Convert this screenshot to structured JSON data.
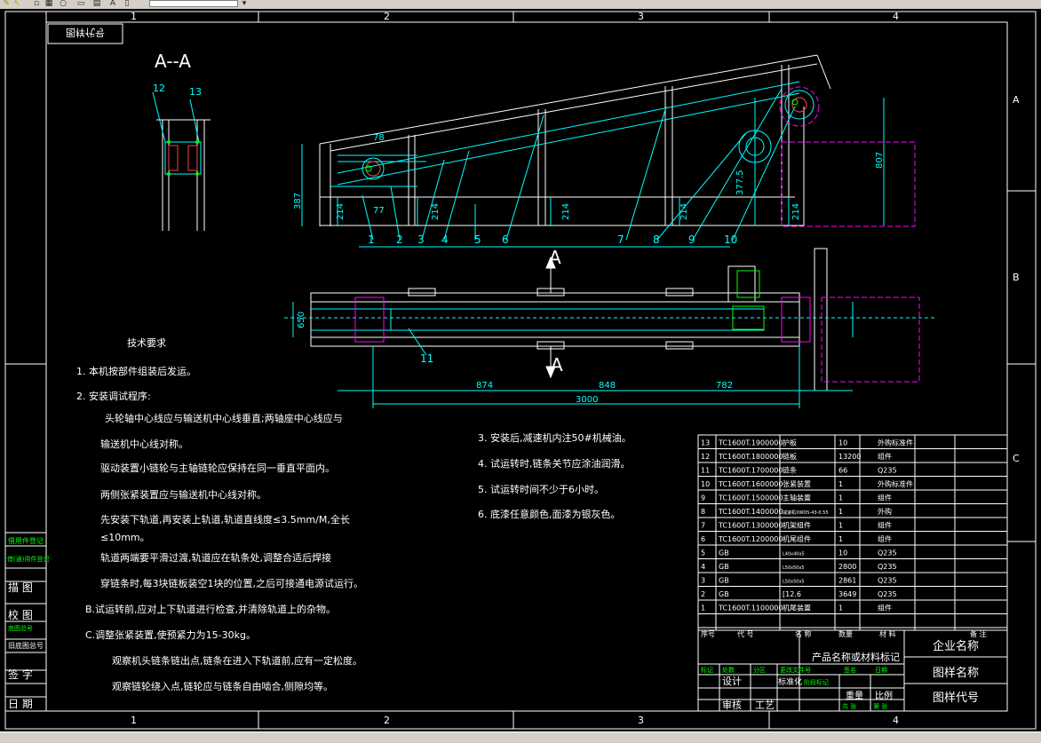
{
  "toolbar": {
    "icons": [
      "pencil-icon",
      "yellow-arrow-icon",
      "small-square-icon",
      "circle-icon",
      "frame-icon",
      "grid-icon",
      "text-icon",
      "rectangle-icon"
    ],
    "layer_value": ""
  },
  "frame": {
    "col_labels": [
      "1",
      "2",
      "3",
      "4"
    ],
    "row_labels": [
      "A",
      "B",
      "C"
    ],
    "mirror_title": "图样代号"
  },
  "section": {
    "title": "A--A",
    "balloon_12": "12",
    "balloon_13": "13"
  },
  "elevation": {
    "dims": [
      "78",
      "77",
      "387",
      "214",
      "214",
      "214",
      "214",
      "214",
      "377.5",
      "807"
    ],
    "balloons": [
      "1",
      "2",
      "3",
      "4",
      "5",
      "6",
      "7",
      "8",
      "9",
      "10"
    ]
  },
  "plan": {
    "section_mark": "A",
    "balloon_11": "11",
    "width_dim": "650",
    "dims": [
      "874",
      "848",
      "782",
      "3000"
    ]
  },
  "tech": {
    "heading": "技术要求",
    "lines": [
      "1.  本机按部件组装后发运。",
      "2.  安装调试程序:",
      "头轮轴中心线应与输送机中心线垂直;两轴座中心线应与",
      "输送机中心线对称。",
      "驱动装置小链轮与主轴链轮应保持在同一垂直平面内。",
      "两侧张紧装置应与输送机中心线对称。",
      "先安装下轨道,再安装上轨道,轨道直线度≤3.5mm/M,全长",
      "≤10mm。",
      "轨道两端要平滑过渡,轨道应在轨条处,调整合适后焊接",
      "穿链条时,每3块链板装空1块的位置,之后可接通电源试运行。",
      "B.试运转前,应对上下轨道进行检查,并清除轨道上的杂物。",
      "C.调整张紧装置,使预紧力为15-30kg。",
      "观察机头链条链出点,链条在进入下轨道前,应有一定松度。",
      "观察链轮绕入点,链轮应与链条自由啮合,侧隙均等。"
    ],
    "lines_right": [
      "3.  安装后,减速机内注50#机械油。",
      "4.  试运转时,链条关节应涂油润滑。",
      "5.  试运转时间不少于6小时。",
      "6.  底漆任意颜色,面漆为银灰色。"
    ]
  },
  "left_strip": {
    "labels": [
      "借(通)用件登记",
      "旧底图总号",
      "描 图",
      "校 图",
      "底图总号",
      "签 字",
      "日 期",
      "借用件登记",
      "描图",
      "校对",
      "日期"
    ]
  },
  "bom": {
    "rows": [
      {
        "no": "13",
        "code": "TC1600T.1900000",
        "name": "护板",
        "qty": "10",
        "mat": "外购标准件"
      },
      {
        "no": "12",
        "code": "TC1600T.1800000",
        "name": "链板",
        "qty": "13200",
        "mat": "组件"
      },
      {
        "no": "11",
        "code": "TC1600T.1700000",
        "name": "链条",
        "qty": "66",
        "mat": "Q235"
      },
      {
        "no": "10",
        "code": "TC1600T.1600000",
        "name": "张紧装置",
        "qty": "1",
        "mat": "外购标准件"
      },
      {
        "no": "9",
        "code": "TC1600T.1500000",
        "name": "主轴装置",
        "qty": "1",
        "mat": "组件"
      },
      {
        "no": "8",
        "code": "TC1600T.1400000",
        "name": "减速机XWD5-43-0.55",
        "qty": "1",
        "mat": "外购"
      },
      {
        "no": "7",
        "code": "TC1600T.1300000",
        "name": "机架组件",
        "qty": "1",
        "mat": "组件"
      },
      {
        "no": "6",
        "code": "TC1600T.1200000",
        "name": "机尾组件",
        "qty": "1",
        "mat": "组件"
      },
      {
        "no": "5",
        "code": "GB",
        "name": "L40x40x5",
        "qty": "10",
        "mat": "Q235"
      },
      {
        "no": "4",
        "code": "GB",
        "name": "L50x50x5",
        "qty": "2800",
        "mat": "Q235"
      },
      {
        "no": "3",
        "code": "GB",
        "name": "L50x50x5",
        "qty": "2861",
        "mat": "Q235"
      },
      {
        "no": "2",
        "code": "GB",
        "name": "[12.6",
        "qty": "3649",
        "mat": "Q235"
      },
      {
        "no": "1",
        "code": "TC1600T.1100000",
        "name": "机尾装置",
        "qty": "1",
        "mat": "组件"
      }
    ],
    "header": {
      "no": "序号",
      "code": "代 号",
      "name": "名 称",
      "qty": "数量",
      "mat": "材 料",
      "w1": "单件",
      "w2": "总计",
      "weight": "重量",
      "note": "备 注"
    }
  },
  "title_block": {
    "product": "产品名称或材料标记",
    "company": "企业名称",
    "drawing_name": "图样名称",
    "drawing_code": "图样代号",
    "stage": "阶段标记",
    "weight": "重量",
    "scale": "比例",
    "sheet_total": "共 张",
    "sheet_no": "第 张",
    "design": "设计",
    "standard": "标准化",
    "review": "审核",
    "process": "工艺",
    "date": "日期",
    "mark": "标记",
    "count": "处数",
    "zone": "分区",
    "change": "更改文件号",
    "sign": "签名"
  }
}
